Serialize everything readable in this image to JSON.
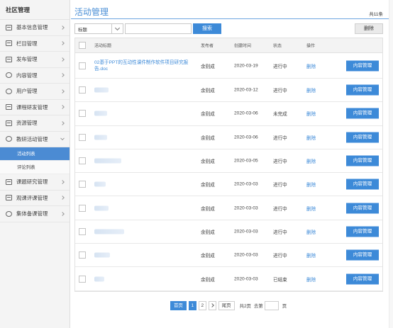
{
  "sidebar": {
    "title": "社区管理",
    "items": [
      {
        "label": "基本信息管理",
        "icon": "monitor-icon"
      },
      {
        "label": "栏目管理",
        "icon": "grid-icon"
      },
      {
        "label": "发布管理",
        "icon": "edit-icon"
      },
      {
        "label": "内容管理",
        "icon": "chat-icon"
      },
      {
        "label": "用户管理",
        "icon": "user-icon"
      },
      {
        "label": "课程研发管理",
        "icon": "book-icon"
      },
      {
        "label": "资源管理",
        "icon": "doc-icon"
      },
      {
        "label": "教研活动管理",
        "icon": "chat-icon",
        "expanded": true
      },
      {
        "label": "课题研究管理",
        "icon": "monitor-icon"
      },
      {
        "label": "观课评课管理",
        "icon": "eye-icon"
      },
      {
        "label": "集体备课管理",
        "icon": "chat-icon"
      }
    ],
    "subitems": [
      {
        "label": "活动列表",
        "active": true
      },
      {
        "label": "评论列表",
        "active": false
      }
    ]
  },
  "header": {
    "title": "活动管理",
    "total": "共11条"
  },
  "toolbar": {
    "select_value": "标题",
    "search_label": "搜索",
    "delete_label": "删除"
  },
  "table": {
    "columns": [
      "活动标题",
      "发布者",
      "创建时间",
      "状态",
      "操作"
    ],
    "op_label": "删除",
    "action_label": "内容管理",
    "rows": [
      {
        "title": "02基于PPT的互动性课件制作软件项目研究报告.doc",
        "publisher": "余则成",
        "date": "2020-03-19",
        "status": "进行中"
      },
      {
        "title": "",
        "publisher": "余则成",
        "date": "2020-03-12",
        "status": "进行中"
      },
      {
        "title": "",
        "publisher": "余则成",
        "date": "2020-03-06",
        "status": "未完成"
      },
      {
        "title": "",
        "publisher": "余则成",
        "date": "2020-03-06",
        "status": "进行中"
      },
      {
        "title": "",
        "publisher": "余则成",
        "date": "2020-03-05",
        "status": "进行中"
      },
      {
        "title": "",
        "publisher": "余则成",
        "date": "2020-03-03",
        "status": "进行中"
      },
      {
        "title": "",
        "publisher": "余则成",
        "date": "2020-03-03",
        "status": "进行中"
      },
      {
        "title": "",
        "publisher": "余则成",
        "date": "2020-03-03",
        "status": "进行中"
      },
      {
        "title": "",
        "publisher": "余则成",
        "date": "2020-03-03",
        "status": "进行中"
      },
      {
        "title": "",
        "publisher": "余则成",
        "date": "2020-03-03",
        "status": "已结束"
      }
    ]
  },
  "pager": {
    "first": "首页",
    "pages": [
      "1",
      "2"
    ],
    "last": "尾页",
    "total_pages": "共2页",
    "goto": "去第",
    "page_unit": "页"
  }
}
